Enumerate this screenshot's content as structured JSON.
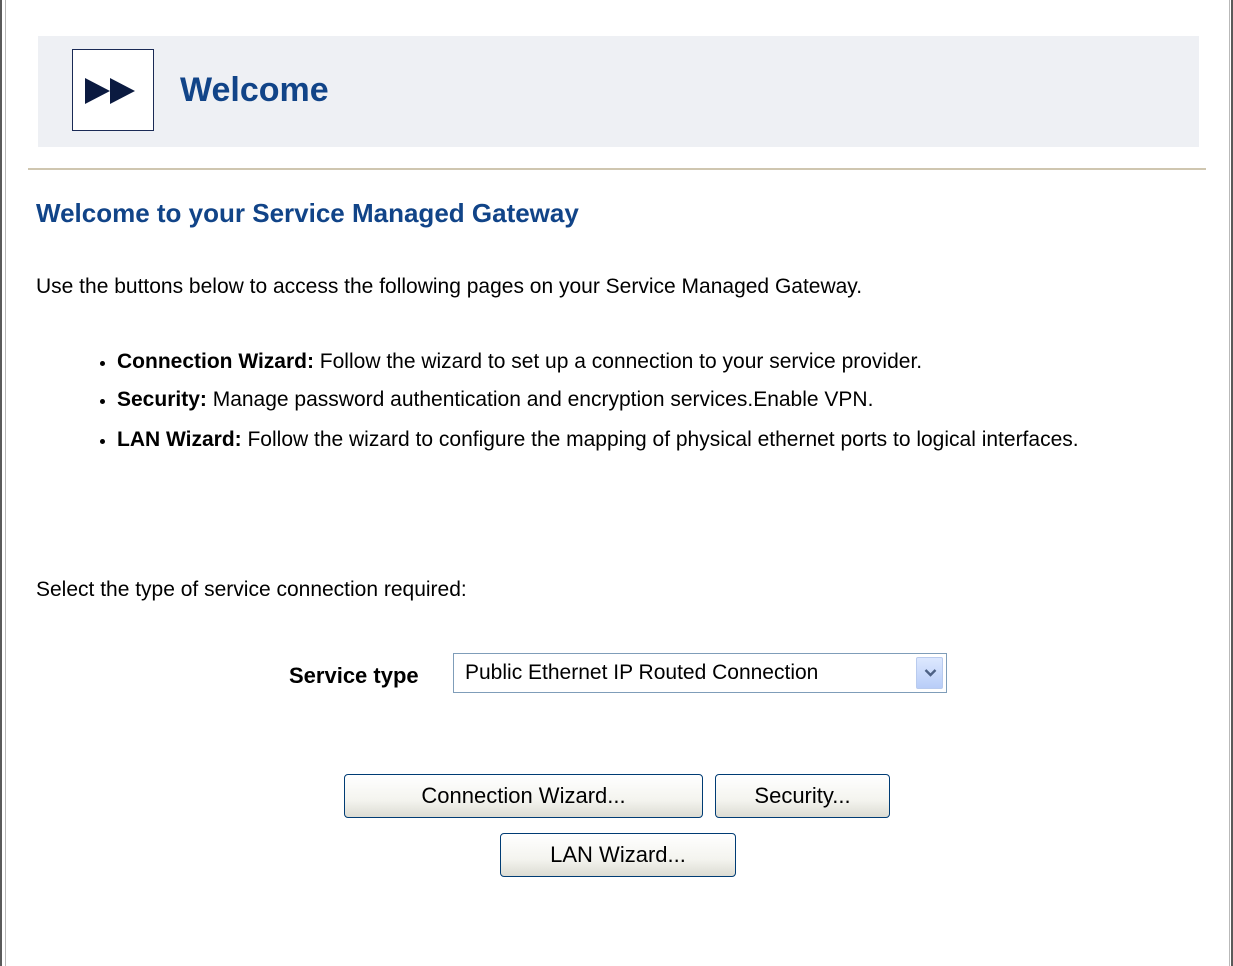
{
  "header": {
    "title": "Welcome",
    "logo_icon": "fast-forward-icon"
  },
  "page": {
    "title": "Welcome to your Service Managed Gateway",
    "intro": "Use the buttons below to access the following pages on your Service Managed Gateway."
  },
  "features": [
    {
      "name": "Connection Wizard:",
      "description": " Follow the wizard to set up a connection to your service provider."
    },
    {
      "name": "Security:",
      "description": " Manage password authentication and encryption services.Enable VPN."
    },
    {
      "name": "LAN Wizard:",
      "description": " Follow the wizard to configure the mapping of physical ethernet ports to logical interfaces."
    }
  ],
  "service": {
    "prompt": "Select the type of service connection required:",
    "label": "Service type",
    "selected_value": "Public Ethernet IP Routed Connection",
    "dropdown_icon": "chevron-down-icon"
  },
  "buttons": {
    "connection_wizard": "Connection Wizard...",
    "security": "Security...",
    "lan_wizard": "LAN Wizard..."
  },
  "colors": {
    "title_blue": "#114488",
    "header_band": "#eef0f4",
    "divider": "#cfc6b0"
  }
}
